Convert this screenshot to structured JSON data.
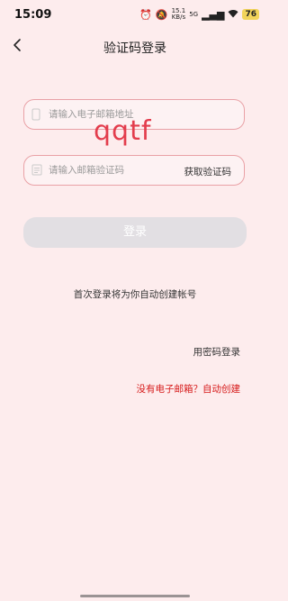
{
  "status_bar": {
    "time": "15:09",
    "net_speed_value": "15.1",
    "net_speed_unit": "KB/s",
    "network_type": "5G",
    "battery": "76"
  },
  "nav": {
    "back_icon": "chevron-left-icon",
    "title": "验证码登录"
  },
  "email_field": {
    "placeholder": "请输入电子邮箱地址",
    "icon": "phone-icon"
  },
  "code_field": {
    "placeholder": "请输入邮箱验证码",
    "icon": "message-icon",
    "get_code_label": "获取验证码"
  },
  "watermark": "qqtf",
  "login_button": "登录",
  "hint": "首次登录将为你自动创建帐号",
  "password_login": "用密码登录",
  "no_email": "没有电子邮箱？自动创建",
  "colors": {
    "background": "#fdeced",
    "input_border": "#e9a1a6",
    "link_red": "#d61a1a",
    "button_disabled": "#e2dfe3",
    "watermark": "#e33d4d"
  }
}
